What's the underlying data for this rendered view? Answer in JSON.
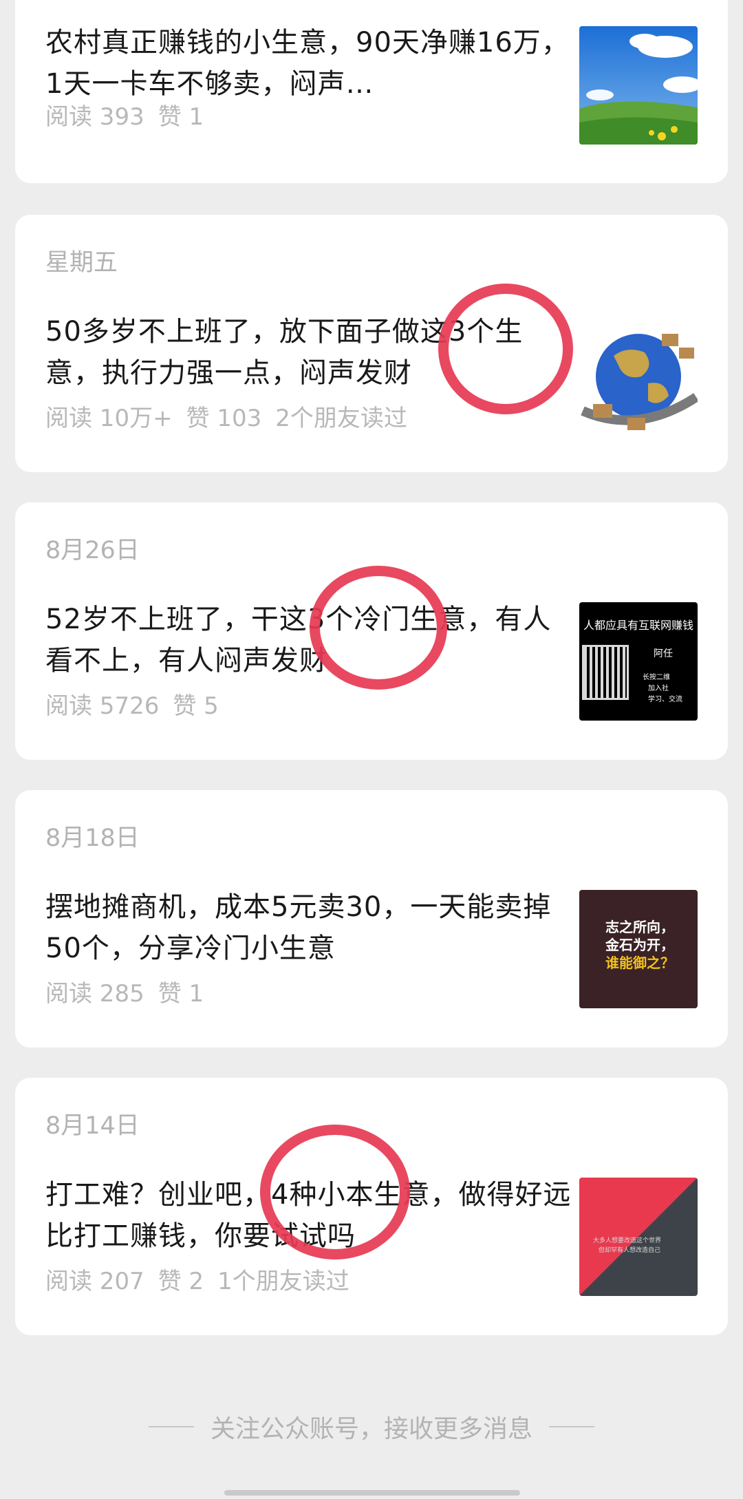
{
  "articles": [
    {
      "date": "",
      "title": "农村真正赚钱的小生意，90天净赚16万，1天一卡车不够卖，闷声…",
      "reads": "阅读 393",
      "likes": "赞 1",
      "friends": "",
      "thumb": "landscape"
    },
    {
      "date": "星期五",
      "title": "50多岁不上班了，放下面子做这3个生意，执行力强一点，闷声发财",
      "reads": "阅读 10万+",
      "likes": "赞 103",
      "friends": "2个朋友读过",
      "thumb": "globe-boxes"
    },
    {
      "date": "8月26日",
      "title": "52岁不上班了，干这3个冷门生意，有人看不上，有人闷声发财",
      "reads": "阅读 5726",
      "likes": "赞 5",
      "friends": "",
      "thumb": "qr-code-card"
    },
    {
      "date": "8月18日",
      "title": "摆地摊商机，成本5元卖30，一天能卖掉50个，分享冷门小生意",
      "reads": "阅读 285",
      "likes": "赞 1",
      "friends": "",
      "thumb": "quote-card"
    },
    {
      "date": "8月14日",
      "title": "打工难？创业吧，4种小本生意，做得好远比打工赚钱，你要试试吗",
      "reads": "阅读 207",
      "likes": "赞 2",
      "friends": "1个朋友读过",
      "thumb": "red-grey-diagonal"
    }
  ],
  "thumb_text": {
    "qr_heading": "人都应具有互联网赚钱",
    "qr_name": "阿任",
    "qr_small_1": "长按二维",
    "qr_small_2": "加入社",
    "qr_small_3": "学习、交流",
    "quote_line1": "志之所向，",
    "quote_line2": "金石为开，",
    "quote_line3": "谁能御之？",
    "diag_line1": "大多人想要改造这个世界",
    "diag_line2": "但却罕有人想改造自己"
  },
  "footer": {
    "text": "关注公众账号，接收更多消息"
  },
  "colors": {
    "accent_green": "#07c160",
    "highlight_red": "#e63a52",
    "quote_yellow": "#f2c21b"
  }
}
